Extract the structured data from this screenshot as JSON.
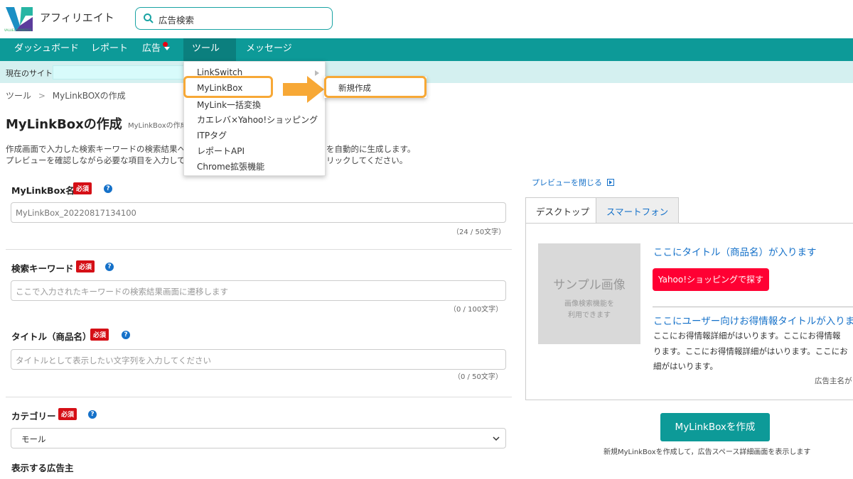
{
  "header": {
    "app_title": "アフィリエイト",
    "logo_caption": "VALUECOMMERCE",
    "search_value": "広告検索"
  },
  "navbar": {
    "items": [
      {
        "label": "ダッシュボード"
      },
      {
        "label": "レポート"
      },
      {
        "label": "広告"
      },
      {
        "label": "ツール"
      },
      {
        "label": "メッセージ"
      }
    ]
  },
  "sitebar": {
    "label": "現在のサイト"
  },
  "breadcrumb": {
    "root": "ツール",
    "sep": ">",
    "current": "MyLinkBOXの作成"
  },
  "page": {
    "title": "MyLinkBoxの作成",
    "subtitle": "MyLinkBoxの作成",
    "desc_line1_a": "作成画面で入力した検索キーワードの検索結果へ",
    "desc_line1_b": "を自動的に生成します。",
    "desc_line2_a": "プレビューを確認しながら必要な項目を入力して",
    "desc_line2_b": "リックしてください。"
  },
  "dropdown": {
    "items": [
      {
        "label": "LinkSwitch"
      },
      {
        "label": "MyLinkBox"
      },
      {
        "label": "MyLink一括変換"
      },
      {
        "label": "カエレバ×Yahoo!ショッピング"
      },
      {
        "label": "ITPタグ"
      },
      {
        "label": "レポートAPI"
      },
      {
        "label": "Chrome拡張機能"
      }
    ],
    "submenu_item": "新規作成"
  },
  "form": {
    "required_label": "必須",
    "help_label": "?",
    "name_label": "MyLinkBox名",
    "name_value": "MyLinkBox_20220817134100",
    "name_counter": "（24 / 50文字）",
    "keyword_label": "検索キーワード",
    "keyword_placeholder": "ここで入力されたキーワードの検索結果画面に遷移します",
    "keyword_counter": "（0 / 100文字）",
    "title_label": "タイトル（商品名）",
    "title_placeholder": "タイトルとして表示したい文字列を入力してください",
    "title_counter": "（0 / 50文字）",
    "category_label": "カテゴリー",
    "category_value": "モール",
    "advertiser_label": "表示する広告主"
  },
  "preview": {
    "close_label": "プレビューを閉じる",
    "tab_desktop": "デスクトップ",
    "tab_smartphone": "スマートフォン",
    "sample_title": "サンプル画像",
    "sample_sub1": "画像検索機能を",
    "sample_sub2": "利用できます",
    "product_title": "ここにタイトル（商品名）が入ります",
    "yahoo_button": "Yahoo!ショッピングで探す",
    "deal_title": "ここにユーザー向けお得情報タイトルが入りま",
    "deal_line1": "ここにお得情報詳細がはいります。ここにお得情報",
    "deal_line2": "ります。ここにお得情報詳細がはいります。ここにお",
    "deal_line3": "細がはいります。",
    "advertiser_name": "広告主名が"
  },
  "actions": {
    "create_button": "MyLinkBoxを作成",
    "create_note": "新規MyLinkBoxを作成して，広告スペース詳細画面を表示します"
  },
  "colors": {
    "accent": "#0d9a98",
    "required": "#d50f16",
    "highlight": "#f7a836",
    "yahoo": "#ff0033",
    "link": "#1571c9"
  }
}
